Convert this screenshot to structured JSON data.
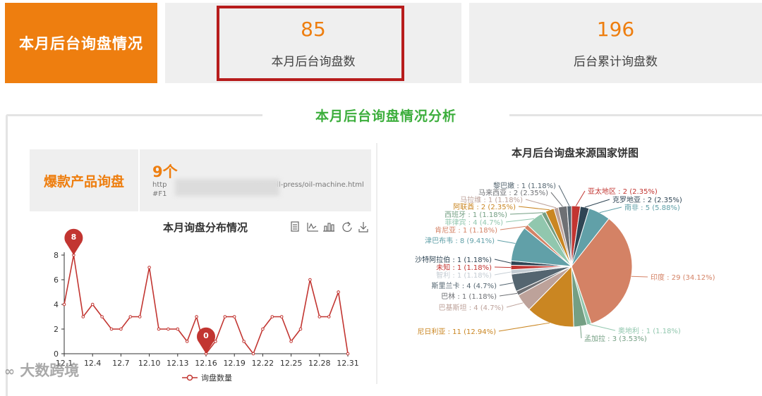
{
  "header": {
    "title": "本月后台询盘情况",
    "month_count": "85",
    "month_label": "本月后台询盘数",
    "total_count": "196",
    "total_label": "后台累计询盘数"
  },
  "section": {
    "title": "本月后台询盘情况分析"
  },
  "hot_product": {
    "label": "爆款产品询盘",
    "count": "9个",
    "url_start": "http",
    "url_end": "crew-oil-press/oil-machine.html#F1"
  },
  "watermark": "大数跨境",
  "colors": {
    "accent": "#ee7e0f",
    "green": "#3cae3c",
    "line": "#c23531"
  },
  "chart_data": [
    {
      "type": "line",
      "title": "本月询盘分布情况",
      "x": [
        "12.1",
        "12.2",
        "12.3",
        "12.4",
        "12.5",
        "12.6",
        "12.7",
        "12.8",
        "12.9",
        "12.10",
        "12.11",
        "12.12",
        "12.13",
        "12.14",
        "12.15",
        "12.16",
        "12.17",
        "12.18",
        "12.19",
        "12.20",
        "12.21",
        "12.22",
        "12.23",
        "12.24",
        "12.25",
        "12.26",
        "12.27",
        "12.28",
        "12.29",
        "12.30",
        "12.31"
      ],
      "x_tick_labels": [
        "12.1",
        "12.4",
        "12.7",
        "12.10",
        "12.13",
        "12.16",
        "12.19",
        "12.22",
        "12.25",
        "12.28",
        "12.31"
      ],
      "series": [
        {
          "name": "询盘数量",
          "values": [
            4,
            8,
            3,
            4,
            3,
            2,
            2,
            3,
            3,
            7,
            2,
            2,
            2,
            1,
            3,
            0,
            1,
            3,
            3,
            1,
            0,
            2,
            3,
            3,
            1,
            2,
            6,
            3,
            3,
            5,
            0
          ]
        }
      ],
      "ylim": [
        0,
        8
      ],
      "y_ticks": [
        "0",
        "2",
        "4",
        "6",
        "8"
      ],
      "max_marker": "8",
      "min_marker": "0",
      "legend_position": "bottom",
      "grid": false
    },
    {
      "type": "pie",
      "title": "本月后台询盘来源国家饼图",
      "slices": [
        {
          "name": "亚太地区",
          "value": 2,
          "percent": "2.35%",
          "label": "亚太地区 : 2 (2.35%)",
          "color": "#c23531"
        },
        {
          "name": "克罗地亚",
          "value": 2,
          "percent": "2.35%",
          "label": "克罗地亚 : 2 (2.35%)",
          "color": "#2f4554"
        },
        {
          "name": "南非",
          "value": 5,
          "percent": "5.88%",
          "label": "南非 : 5 (5.88%)",
          "color": "#61a0a8"
        },
        {
          "name": "印度",
          "value": 29,
          "percent": "34.12%",
          "label": "印度 : 29 (34.12%)",
          "color": "#d48265"
        },
        {
          "name": "奥地利",
          "value": 1,
          "percent": "1.18%",
          "label": "奥地利 : 1 (1.18%)",
          "color": "#91c7ae"
        },
        {
          "name": "孟加拉",
          "value": 3,
          "percent": "3.53%",
          "label": "孟加拉 : 3 (3.53%)",
          "color": "#749f83"
        },
        {
          "name": "尼日利亚",
          "value": 11,
          "percent": "12.94%",
          "label": "尼日利亚 : 11 (12.94%)",
          "color": "#ca8622"
        },
        {
          "name": "巴基斯坦",
          "value": 4,
          "percent": "4.7%",
          "label": "巴基斯坦 : 4 (4.7%)",
          "color": "#bda29a"
        },
        {
          "name": "巴林",
          "value": 1,
          "percent": "1.18%",
          "label": "巴林 : 1 (1.18%)",
          "color": "#6e7074"
        },
        {
          "name": "斯里兰卡",
          "value": 4,
          "percent": "4.7%",
          "label": "斯里兰卡 : 4 (4.7%)",
          "color": "#546570"
        },
        {
          "name": "智利",
          "value": 1,
          "percent": "1.18%",
          "label": "智利 : 1 (1.18%)",
          "color": "#c4ccd3"
        },
        {
          "name": "未知",
          "value": 1,
          "percent": "1.18%",
          "label": "未知 : 1 (1.18%)",
          "color": "#c23531"
        },
        {
          "name": "沙特阿拉伯",
          "value": 1,
          "percent": "1.18%",
          "label": "沙特阿拉伯 : 1 (1.18%)",
          "color": "#2f4554"
        },
        {
          "name": "津巴布韦",
          "value": 8,
          "percent": "9.41%",
          "label": "津巴布韦 : 8 (9.41%)",
          "color": "#61a0a8"
        },
        {
          "name": "肯尼亚",
          "value": 1,
          "percent": "1.18%",
          "label": "肯尼亚 : 1 (1.18%)",
          "color": "#d48265"
        },
        {
          "name": "菲律宾",
          "value": 4,
          "percent": "4.7%",
          "label": "菲律宾 : 4 (4.7%)",
          "color": "#91c7ae"
        },
        {
          "name": "西班牙",
          "value": 1,
          "percent": "1.18%",
          "label": "西班牙 : 1 (1.18%)",
          "color": "#749f83"
        },
        {
          "name": "阿联酋",
          "value": 2,
          "percent": "2.35%",
          "label": "阿联酋 : 2 (2.35%)",
          "color": "#ca8622"
        },
        {
          "name": "马拉维",
          "value": 1,
          "percent": "1.18%",
          "label": "马拉维 : 1 (1.18%)",
          "color": "#bda29a"
        },
        {
          "name": "马来西亚",
          "value": 2,
          "percent": "2.35%",
          "label": "马来西亚 : 2 (2.35%)",
          "color": "#6e7074"
        },
        {
          "name": "黎巴嫩",
          "value": 1,
          "percent": "1.18%",
          "label": "黎巴嫩 : 1 (1.18%)",
          "color": "#546570"
        }
      ]
    }
  ]
}
